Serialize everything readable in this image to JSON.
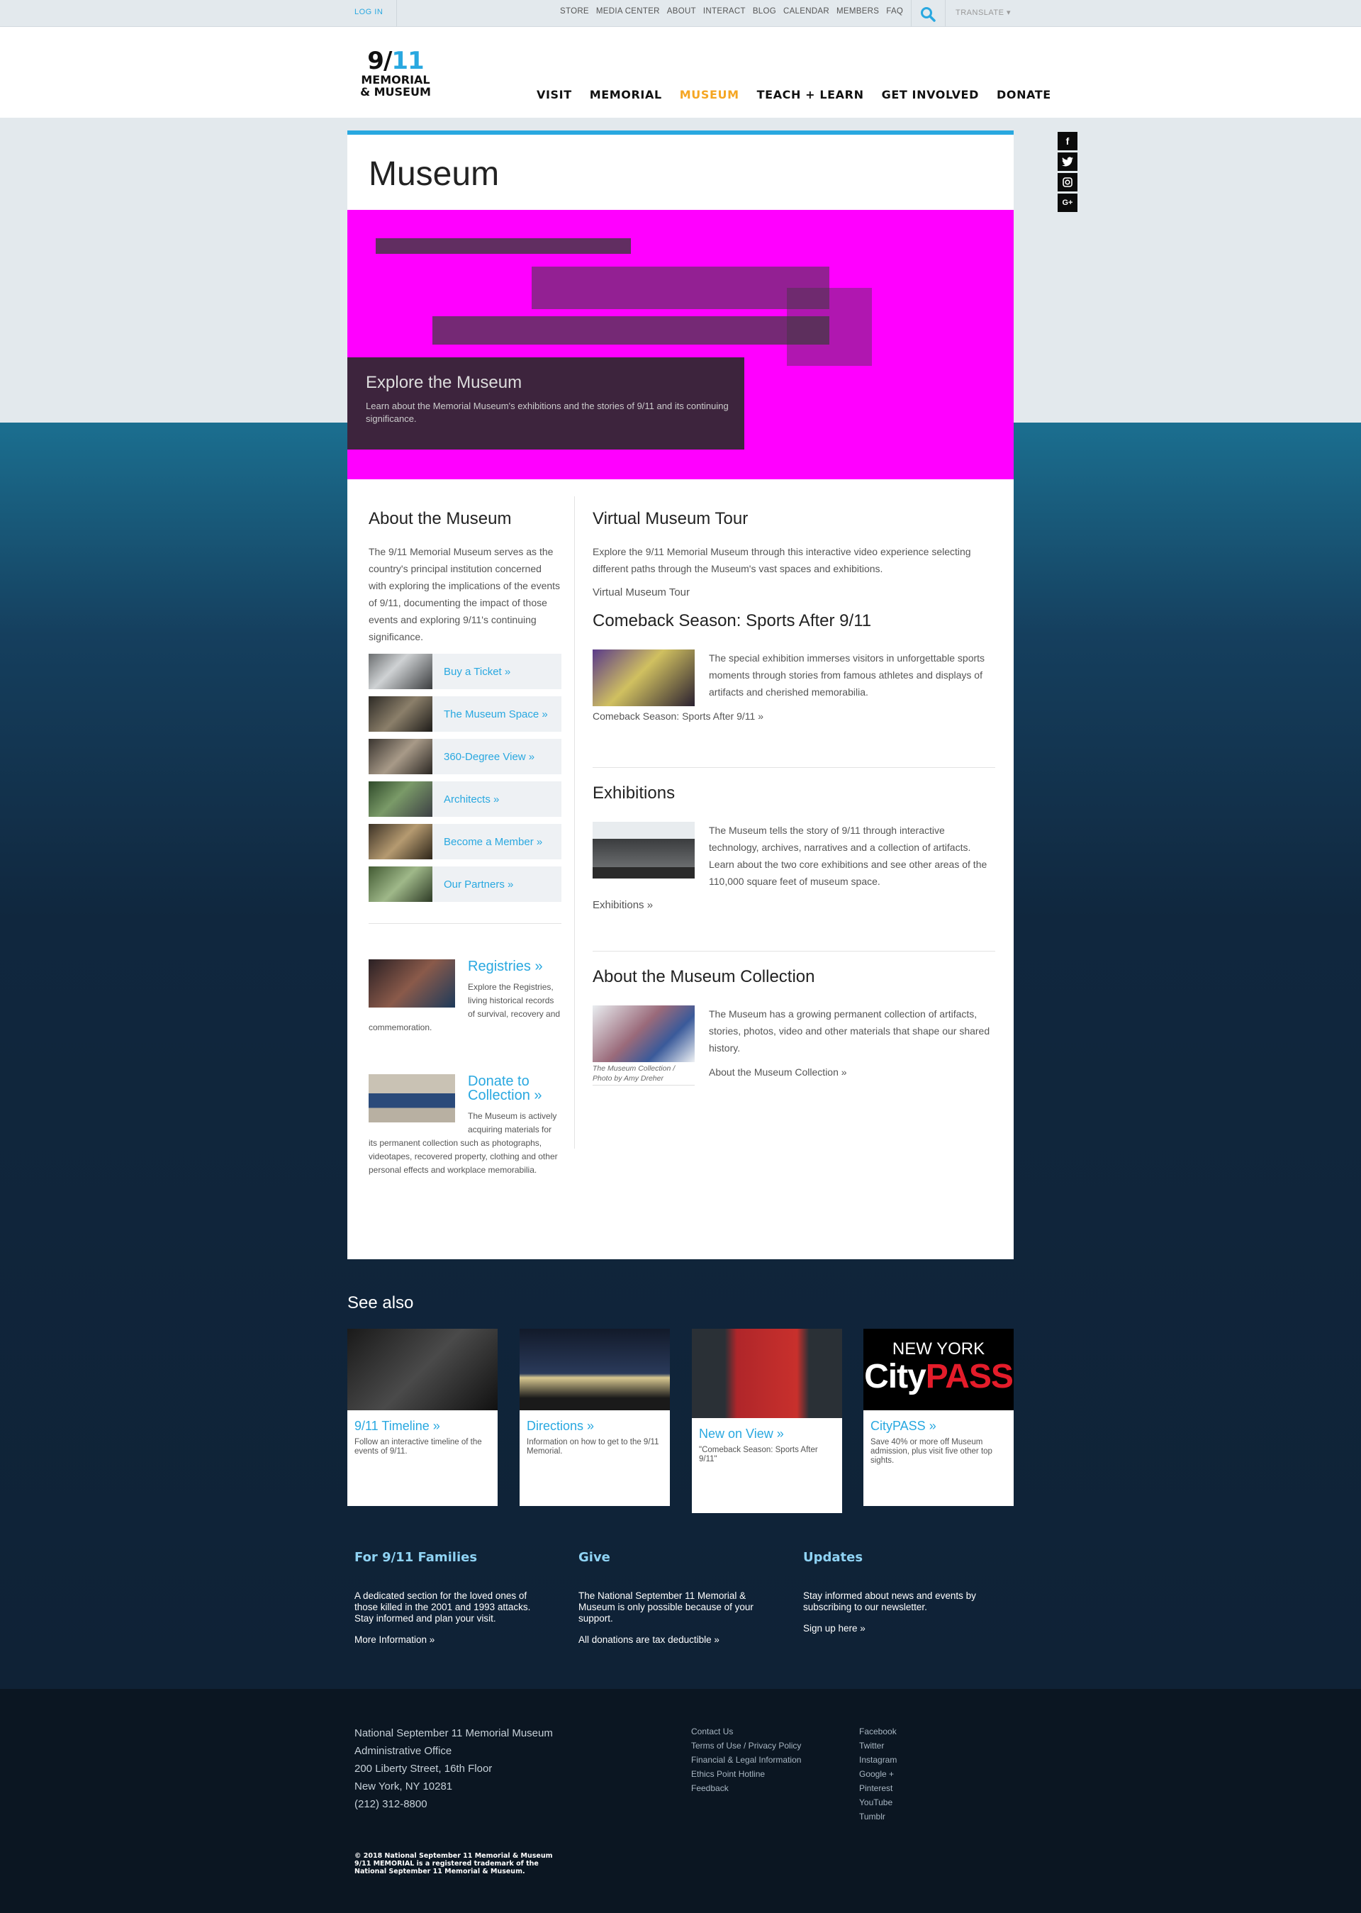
{
  "topbar": {
    "login": "LOG IN",
    "utility": [
      "STORE",
      "MEDIA CENTER",
      "ABOUT",
      "INTERACT",
      "BLOG",
      "CALENDAR",
      "MEMBERS",
      "FAQ"
    ],
    "translate": "TRANSLATE ▾"
  },
  "logo": {
    "line1a": "9/",
    "line1b": "11",
    "line2": "MEMORIAL",
    "line3": "& MUSEUM"
  },
  "nav": {
    "items": [
      "VISIT",
      "MEMORIAL",
      "MUSEUM",
      "TEACH + LEARN",
      "GET INVOLVED",
      "DONATE"
    ],
    "active": "MUSEUM"
  },
  "social": [
    "f",
    "t",
    "i",
    "G+"
  ],
  "page": {
    "title": "Museum"
  },
  "hero": {
    "title": "Explore the Museum",
    "text": "Learn about the Memorial Museum's exhibitions and the stories of 9/11 and its continuing significance."
  },
  "about": {
    "title": "About the Museum",
    "text": "The 9/11 Memorial Museum serves as the country's principal institution concerned with exploring the implications of the events of 9/11, documenting the impact of those events and exploring 9/11's continuing significance.",
    "links": [
      "Buy a Ticket  »",
      "The Museum Space  »",
      "360-Degree View  »",
      "Architects  »",
      "Become a Member  »",
      "Our Partners  »"
    ]
  },
  "registries": {
    "title": "Registries »",
    "text": "Explore the Registries, living historical records of survival, recovery and commemoration."
  },
  "donate": {
    "title": "Donate to Collection »",
    "text": "The Museum is actively acquiring materials for its permanent collection such as photographs, videotapes, recovered property, clothing and other personal effects and workplace memorabilia."
  },
  "tour": {
    "title": "Virtual Museum Tour",
    "text": "Explore the 9/11 Memorial Museum through this interactive video experience selecting different paths through the Museum's vast spaces and exhibitions.",
    "link": "Virtual Museum Tour"
  },
  "comeback": {
    "title": "Comeback Season: Sports After 9/11",
    "text": "The special exhibition immerses visitors in unforgettable sports moments through stories from famous athletes and displays of artifacts and cherished memorabilia.",
    "link": "Comeback Season: Sports After 9/11 »"
  },
  "exhibitions": {
    "title": "Exhibitions",
    "text": "The Museum tells the story of 9/11 through interactive technology, archives, narratives and a collection of artifacts. Learn about the two core exhibitions and see other areas of the 110,000 square feet of museum space.",
    "link": "Exhibitions »"
  },
  "collection": {
    "title": "About the Museum Collection",
    "text": "The Museum has a growing permanent collection of artifacts, stories, photos, video and other materials that shape our shared history.",
    "link": "About the Museum Collection »",
    "caption": "The Museum Collection / Photo by Amy Dreher"
  },
  "seealso": {
    "title": "See also",
    "cards": [
      {
        "title": "9/11 Timeline »",
        "text": "Follow an interactive timeline of the events of 9/11."
      },
      {
        "title": "Directions »",
        "text": "Information on how to get to the 9/11 Memorial."
      },
      {
        "title": "New on View »",
        "text": "\"Comeback Season: Sports After 9/11\""
      },
      {
        "title": "CityPASS »",
        "text": "Save 40% or more off Museum admission, plus visit five other top sights.",
        "logo_top": "NEW YORK",
        "logo_a": "City",
        "logo_b": "PASS"
      }
    ]
  },
  "promos": [
    {
      "title": "For 9/11 Families",
      "text": "A dedicated section for the loved ones of those killed in the 2001 and 1993 attacks. Stay informed and plan your visit.",
      "link": "More Information »"
    },
    {
      "title": "Give",
      "text": "The National September 11 Memorial & Museum is only possible because of your support.",
      "link": "All donations are tax deductible »"
    },
    {
      "title": "Updates",
      "text": "Stay informed about news and events by subscribing to our newsletter.",
      "link": "Sign up here »"
    }
  ],
  "footer": {
    "address": [
      "National September 11 Memorial Museum",
      "Administrative Office",
      "200 Liberty Street, 16th Floor",
      "New York, NY 10281",
      "(212) 312-8800"
    ],
    "links1": [
      "Contact Us",
      "Terms of Use / Privacy Policy",
      "Financial & Legal Information",
      "Ethics Point Hotline",
      "Feedback"
    ],
    "links2": [
      "Facebook",
      "Twitter",
      "Instagram",
      "Google +",
      "Pinterest",
      "YouTube",
      "Tumblr"
    ],
    "copyright": [
      "© 2018 National September 11 Memorial & Museum",
      "9/11 MEMORIAL is a registered trademark of the",
      "National September 11 Memorial & Museum."
    ]
  },
  "colors": {
    "accent": "#29a8e0",
    "nav_active": "#f5a623",
    "hero_placeholder": "#ff00ff"
  }
}
